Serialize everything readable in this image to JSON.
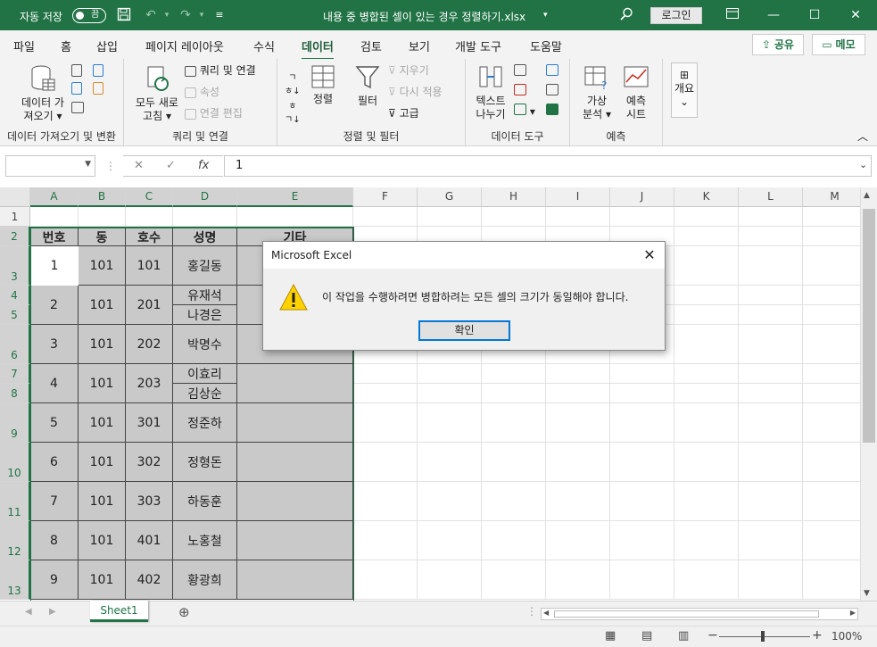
{
  "titlebar": {
    "autosave_label": "자동 저장",
    "autosave_state": "끔",
    "document_title": "내용 중 병합된 셀이 있는 경우 정렬하기.xlsx",
    "login_label": "로그인"
  },
  "tabs": [
    "파일",
    "홈",
    "삽입",
    "페이지 레이아웃",
    "수식",
    "데이터",
    "검토",
    "보기",
    "개발 도구",
    "도움말"
  ],
  "active_tab": "데이터",
  "share_label": "공유",
  "memo_label": "메모",
  "ribbon": {
    "get_data": {
      "label1": "데이터 가",
      "label2": "져오기",
      "group": "데이터 가져오기 및 변환"
    },
    "queries": {
      "refresh1": "모두 새로",
      "refresh2": "고침",
      "query_conn": "쿼리 및 연결",
      "props": "속성",
      "edit_links": "연결 편집",
      "group": "쿼리 및 연결"
    },
    "sort": {
      "sort": "정렬",
      "filter": "필터",
      "clear": "지우기",
      "reapply": "다시 적용",
      "advanced": "고급",
      "group": "정렬 및 필터"
    },
    "tools": {
      "text1": "텍스트",
      "text2": "나누기",
      "group": "데이터 도구"
    },
    "forecast": {
      "whatif1": "가상",
      "whatif2": "분석",
      "sheet1": "예측",
      "sheet2": "시트",
      "group": "예측"
    },
    "outline": {
      "label": "개요"
    }
  },
  "formula": {
    "namebox": "",
    "value": "1",
    "fx": "fx"
  },
  "columns": [
    "A",
    "B",
    "C",
    "D",
    "E",
    "F",
    "G",
    "H",
    "I",
    "J",
    "K",
    "L",
    "M"
  ],
  "rows": [
    "1",
    "2",
    "3",
    "4",
    "5",
    "6",
    "7",
    "8",
    "9",
    "10",
    "11",
    "12",
    "13"
  ],
  "table": {
    "headers": [
      "번호",
      "동",
      "호수",
      "성명",
      "기타"
    ],
    "records": [
      {
        "no": "1",
        "dong": "101",
        "ho": "101",
        "names": [
          "홍길동"
        ]
      },
      {
        "no": "2",
        "dong": "101",
        "ho": "201",
        "names": [
          "유재석",
          "나경은"
        ]
      },
      {
        "no": "3",
        "dong": "101",
        "ho": "202",
        "names": [
          "박명수"
        ]
      },
      {
        "no": "4",
        "dong": "101",
        "ho": "203",
        "names": [
          "이효리",
          "김상순"
        ]
      },
      {
        "no": "5",
        "dong": "101",
        "ho": "301",
        "names": [
          "정준하"
        ]
      },
      {
        "no": "6",
        "dong": "101",
        "ho": "302",
        "names": [
          "정형돈"
        ]
      },
      {
        "no": "7",
        "dong": "101",
        "ho": "303",
        "names": [
          "하동훈"
        ]
      },
      {
        "no": "8",
        "dong": "101",
        "ho": "401",
        "names": [
          "노홍철"
        ]
      },
      {
        "no": "9",
        "dong": "101",
        "ho": "402",
        "names": [
          "황광희"
        ]
      }
    ]
  },
  "sheet_tab": "Sheet1",
  "zoom": "100%",
  "dialog": {
    "title": "Microsoft Excel",
    "message": "이 작업을 수행하려면 병합하려는 모든 셀의 크기가 동일해야 합니다.",
    "ok_label": "확인"
  },
  "colors": {
    "brand": "#217346",
    "cell_fill": "#c9c9c9"
  }
}
